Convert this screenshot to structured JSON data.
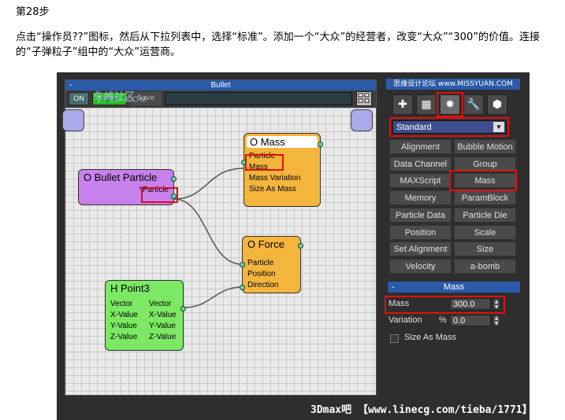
{
  "step_title": "第28步",
  "instruction": "点击“操作员??”图标，然后从下拉列表中，选择“标准”。添加一个“大众”的经营者，改变“大众”“300”的价值。连接的“子弹粒子”组中的“大众”运营商。",
  "editor": {
    "title": "Bullet",
    "minimize": "-",
    "on_label": "ON",
    "valid_label": "Valid",
    "save_label": "Save",
    "watermark_cn": "朱峰社区",
    "watermark_en": "ZF3D.COM"
  },
  "nodes": {
    "bullet": {
      "title": "O Bullet Particle",
      "port": "*Particle"
    },
    "mass": {
      "title": "O Mass",
      "rows": [
        "Particle",
        "Mass",
        "Mass Variation",
        "Size As Mass"
      ]
    },
    "force": {
      "title": "O Force",
      "rows": [
        "Particle",
        "Position",
        "Direction"
      ]
    },
    "point": {
      "title": "H Point3",
      "left": [
        "Vector",
        "X-Value",
        "Y-Value",
        "Z-Value"
      ],
      "right": [
        "Vector",
        "X-Value",
        "Y-Value",
        "Z-Value"
      ]
    }
  },
  "panel": {
    "logo": "思缘设计论坛 www.MISSYUAN.COM",
    "dropdown": {
      "value": "Standard"
    },
    "operators": [
      [
        "Alignment",
        "Bubble Motion"
      ],
      [
        "Data Channel",
        "Group"
      ],
      [
        "MAXScript",
        "Mass"
      ],
      [
        "Memory",
        "ParamBlock"
      ],
      [
        "Particle Data",
        "Particle Die"
      ],
      [
        "Position",
        "Scale"
      ],
      [
        "Set Alignment",
        "Size"
      ],
      [
        "Velocity",
        "a-bomb"
      ]
    ],
    "rollout": {
      "title": "Mass",
      "minimize": "-",
      "mass_label": "Mass",
      "mass_value": "300.0",
      "variation_label": "Variation",
      "variation_unit": "%",
      "variation_value": "0.0",
      "size_as_mass_label": "Size As Mass"
    }
  },
  "footer_watermark": "3Dmax吧 【www.linecg.com/tieba/1771】",
  "colors": {
    "highlight_red": "#e01010",
    "title_blue": "#2a5aa8",
    "node_purple": "#c780ec",
    "node_orange": "#f3b53c",
    "node_green": "#7ce864",
    "port_green": "#54e2a0"
  }
}
